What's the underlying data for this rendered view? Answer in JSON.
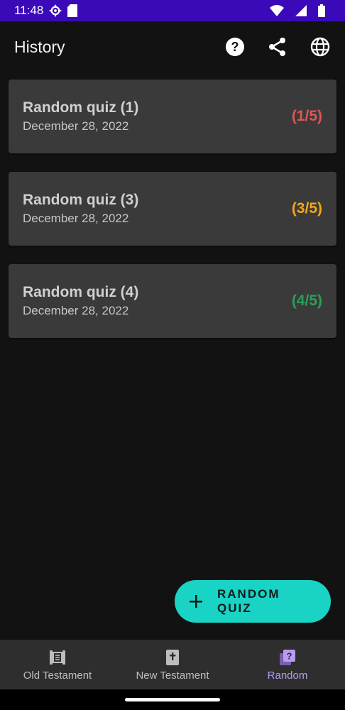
{
  "status_bar": {
    "time": "11:48",
    "icons": [
      "settings-icon",
      "sd-card-icon",
      "wifi-icon",
      "signal-icon",
      "battery-icon"
    ]
  },
  "app_bar": {
    "title": "History",
    "actions": [
      "help-icon",
      "share-icon",
      "language-icon"
    ]
  },
  "quizzes": [
    {
      "title": "Random quiz (1)",
      "date": "December 28, 2022",
      "score": "(1/5)",
      "score_color": "#e25555"
    },
    {
      "title": "Random quiz (3)",
      "date": "December 28, 2022",
      "score": "(3/5)",
      "score_color": "#f2a71b"
    },
    {
      "title": "Random quiz (4)",
      "date": "December 28, 2022",
      "score": "(4/5)",
      "score_color": "#2e9e5b"
    }
  ],
  "fab": {
    "label": "RANDOM QUIZ",
    "color": "#19d3c5"
  },
  "bottom_nav": {
    "items": [
      {
        "label": "Old Testament",
        "icon": "scroll-icon",
        "active": false
      },
      {
        "label": "New Testament",
        "icon": "bible-icon",
        "active": false
      },
      {
        "label": "Random",
        "icon": "question-card-icon",
        "active": true
      }
    ],
    "active_color": "#b79cf0"
  }
}
